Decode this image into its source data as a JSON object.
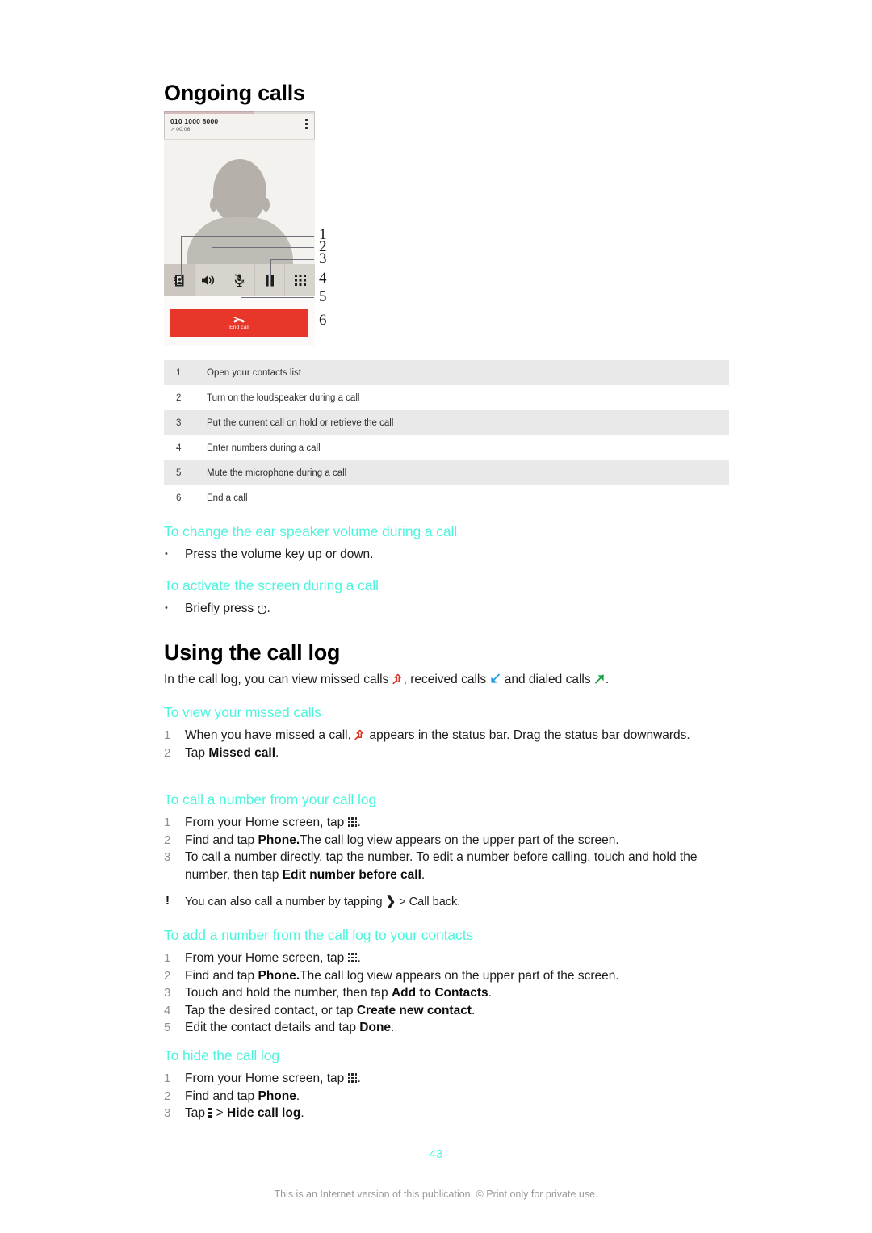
{
  "document": {
    "page_number": "43",
    "footer_note": "This is an Internet version of this publication. © Print only for private use."
  },
  "sections": {
    "ongoing_calls": {
      "heading": "Ongoing calls"
    },
    "using_call_log": {
      "heading": "Using the call log",
      "intro_prefix": "In the call log, you can view missed calls",
      "intro_mid": ", received calls",
      "intro_mid2": "and dialed calls",
      "intro_suffix": "."
    }
  },
  "phone_mockup": {
    "number": "010 1000 8000",
    "call_timer": "00:06",
    "timer_icon": "outgoing-call-icon",
    "menu_icon": "overflow-menu-icon",
    "avatar_icon": "contact-avatar-placeholder",
    "toolbar_buttons": [
      {
        "name": "contacts-icon",
        "label": "Contacts"
      },
      {
        "name": "speaker-icon",
        "label": "Loudspeaker"
      },
      {
        "name": "mute-mic-icon",
        "label": "Mute"
      },
      {
        "name": "hold-pause-icon",
        "label": "Hold"
      },
      {
        "name": "keypad-icon",
        "label": "Keypad"
      }
    ],
    "end_call_label": "End call",
    "end_call_color": "#E8372A",
    "callout_numbers": [
      "1",
      "2",
      "3",
      "4",
      "5",
      "6"
    ]
  },
  "reference_table": {
    "rows": [
      {
        "num": "1",
        "desc": "Open your contacts list"
      },
      {
        "num": "2",
        "desc": "Turn on the loudspeaker during a call"
      },
      {
        "num": "3",
        "desc": "Put the current call on hold or retrieve the call"
      },
      {
        "num": "4",
        "desc": "Enter numbers during a call"
      },
      {
        "num": "5",
        "desc": "Mute the microphone during a call"
      },
      {
        "num": "6",
        "desc": "End a call"
      }
    ]
  },
  "procedures": {
    "change_ear_speaker_volume": {
      "heading": "To change the ear speaker volume during a call",
      "bullet": "Press the volume key up or down."
    },
    "activate_screen": {
      "heading": "To activate the screen during a call",
      "bullet_prefix": "Briefly press",
      "bullet_suffix": ".",
      "power_icon": "power-button-icon"
    },
    "view_missed_calls": {
      "heading": "To view your missed calls",
      "step1_prefix": "When you have missed a call,",
      "step1_suffix": "appears in the status bar. Drag the status bar downwards.",
      "step2_prefix": "Tap",
      "step2_bold": "Missed call",
      "step2_suffix": "."
    },
    "call_number_from_log": {
      "heading": "To call a number from your call log",
      "step1_prefix": "From your Home screen, tap",
      "step1_suffix": ".",
      "step2_prefix": "Find and tap",
      "step2_bold": "Phone.",
      "step2_suffix": "The call log view appears on the upper part of the screen.",
      "step3_prefix": "To call a number directly, tap the number. To edit a number before calling, touch and hold the number, then tap",
      "step3_bold": "Edit number before call",
      "step3_suffix": ".",
      "note_prefix": "You can also call a number by tapping",
      "note_suffix": "> Call back."
    },
    "add_number_to_contacts": {
      "heading": "To add a number from the call log to your contacts",
      "step1_prefix": "From your Home screen, tap",
      "step1_suffix": ".",
      "step2_prefix": "Find and tap",
      "step2_bold": "Phone.",
      "step2_suffix": "The call log view appears on the upper part of the screen.",
      "step3_prefix": "Touch and hold the number, then tap",
      "step3_bold": "Add to Contacts",
      "step3_suffix": ".",
      "step4_prefix": "Tap the desired contact, or tap",
      "step4_bold": "Create new contact",
      "step4_suffix": ".",
      "step5_prefix": "Edit the contact details and tap",
      "step5_bold": "Done",
      "step5_suffix": "."
    },
    "hide_call_log": {
      "heading": "To hide the call log",
      "step1_prefix": "From your Home screen, tap",
      "step1_suffix": ".",
      "step2_prefix": "Find and tap",
      "step2_bold": "Phone",
      "step2_suffix": ".",
      "step3_prefix": "Tap",
      "step3_mid": ">",
      "step3_bold": "Hide call log",
      "step3_suffix": "."
    }
  },
  "colors": {
    "heading_accent": "#4DF5DC",
    "missed_call": "#E02B20",
    "received_call": "#1E9BE0",
    "dialed_call": "#14A03C",
    "table_stripe": "#E9E9E9"
  }
}
